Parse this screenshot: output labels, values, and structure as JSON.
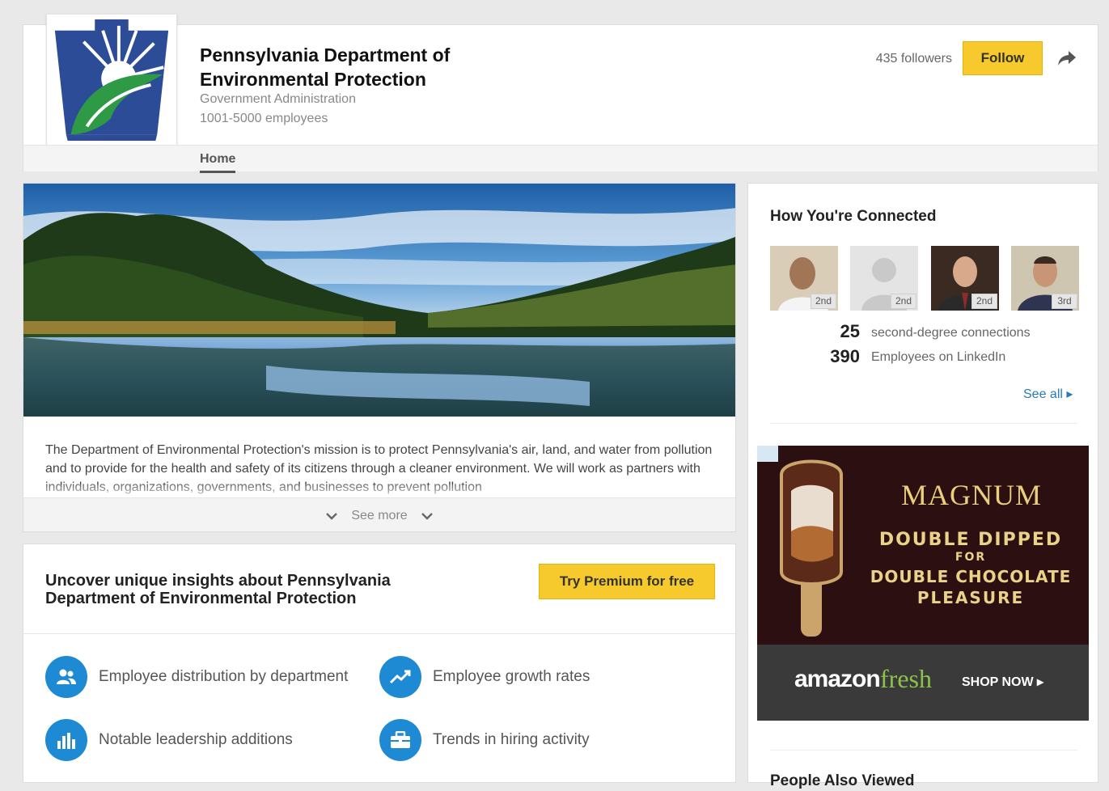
{
  "company": {
    "name": "Pennsylvania Department of Environmental Protection",
    "industry": "Government Administration",
    "size": "1001-5000 employees",
    "followers": "435 followers",
    "follow_label": "Follow",
    "tabs": [
      {
        "label": "Home"
      }
    ]
  },
  "overview": {
    "description": "The Department of Environmental Protection's mission is to protect Pennsylvania's air, land, and water from pollution and to provide for the health and safety of its citizens through a cleaner environment. We will work as partners with individuals, organizations, governments, and businesses to prevent pollution",
    "see_more": "See more"
  },
  "premium": {
    "title": "Uncover unique insights about Pennsylvania Department of Environmental Protection",
    "button_label": "Try Premium for free",
    "features": [
      {
        "label": "Employee distribution by department",
        "icon": "people-icon"
      },
      {
        "label": "Employee growth rates",
        "icon": "trend-icon"
      },
      {
        "label": "Notable leadership additions",
        "icon": "bar-chart-icon"
      },
      {
        "label": "Trends in hiring activity",
        "icon": "briefcase-icon"
      }
    ]
  },
  "connections": {
    "title": "How You're Connected",
    "avatars": [
      {
        "degree": "2nd"
      },
      {
        "degree": "2nd"
      },
      {
        "degree": "2nd"
      },
      {
        "degree": "3rd"
      }
    ],
    "stats": [
      {
        "value": "25",
        "label": "second-degree connections"
      },
      {
        "value": "390",
        "label": "Employees on LinkedIn"
      }
    ],
    "see_all": "See all ▸"
  },
  "ad": {
    "brand": "MAGNUM",
    "line1": "DOUBLE DIPPED",
    "line2": "FOR",
    "line3": "DOUBLE CHOCOLATE",
    "line4": "PLEASURE",
    "store_a": "amazon",
    "store_b": "fresh",
    "cta": "SHOP NOW ▸"
  },
  "people_also_viewed": {
    "title": "People Also Viewed"
  },
  "colors": {
    "accent_yellow": "#f6c92d",
    "link_blue": "#2a7ab8",
    "icon_blue": "#1e8ad4"
  }
}
